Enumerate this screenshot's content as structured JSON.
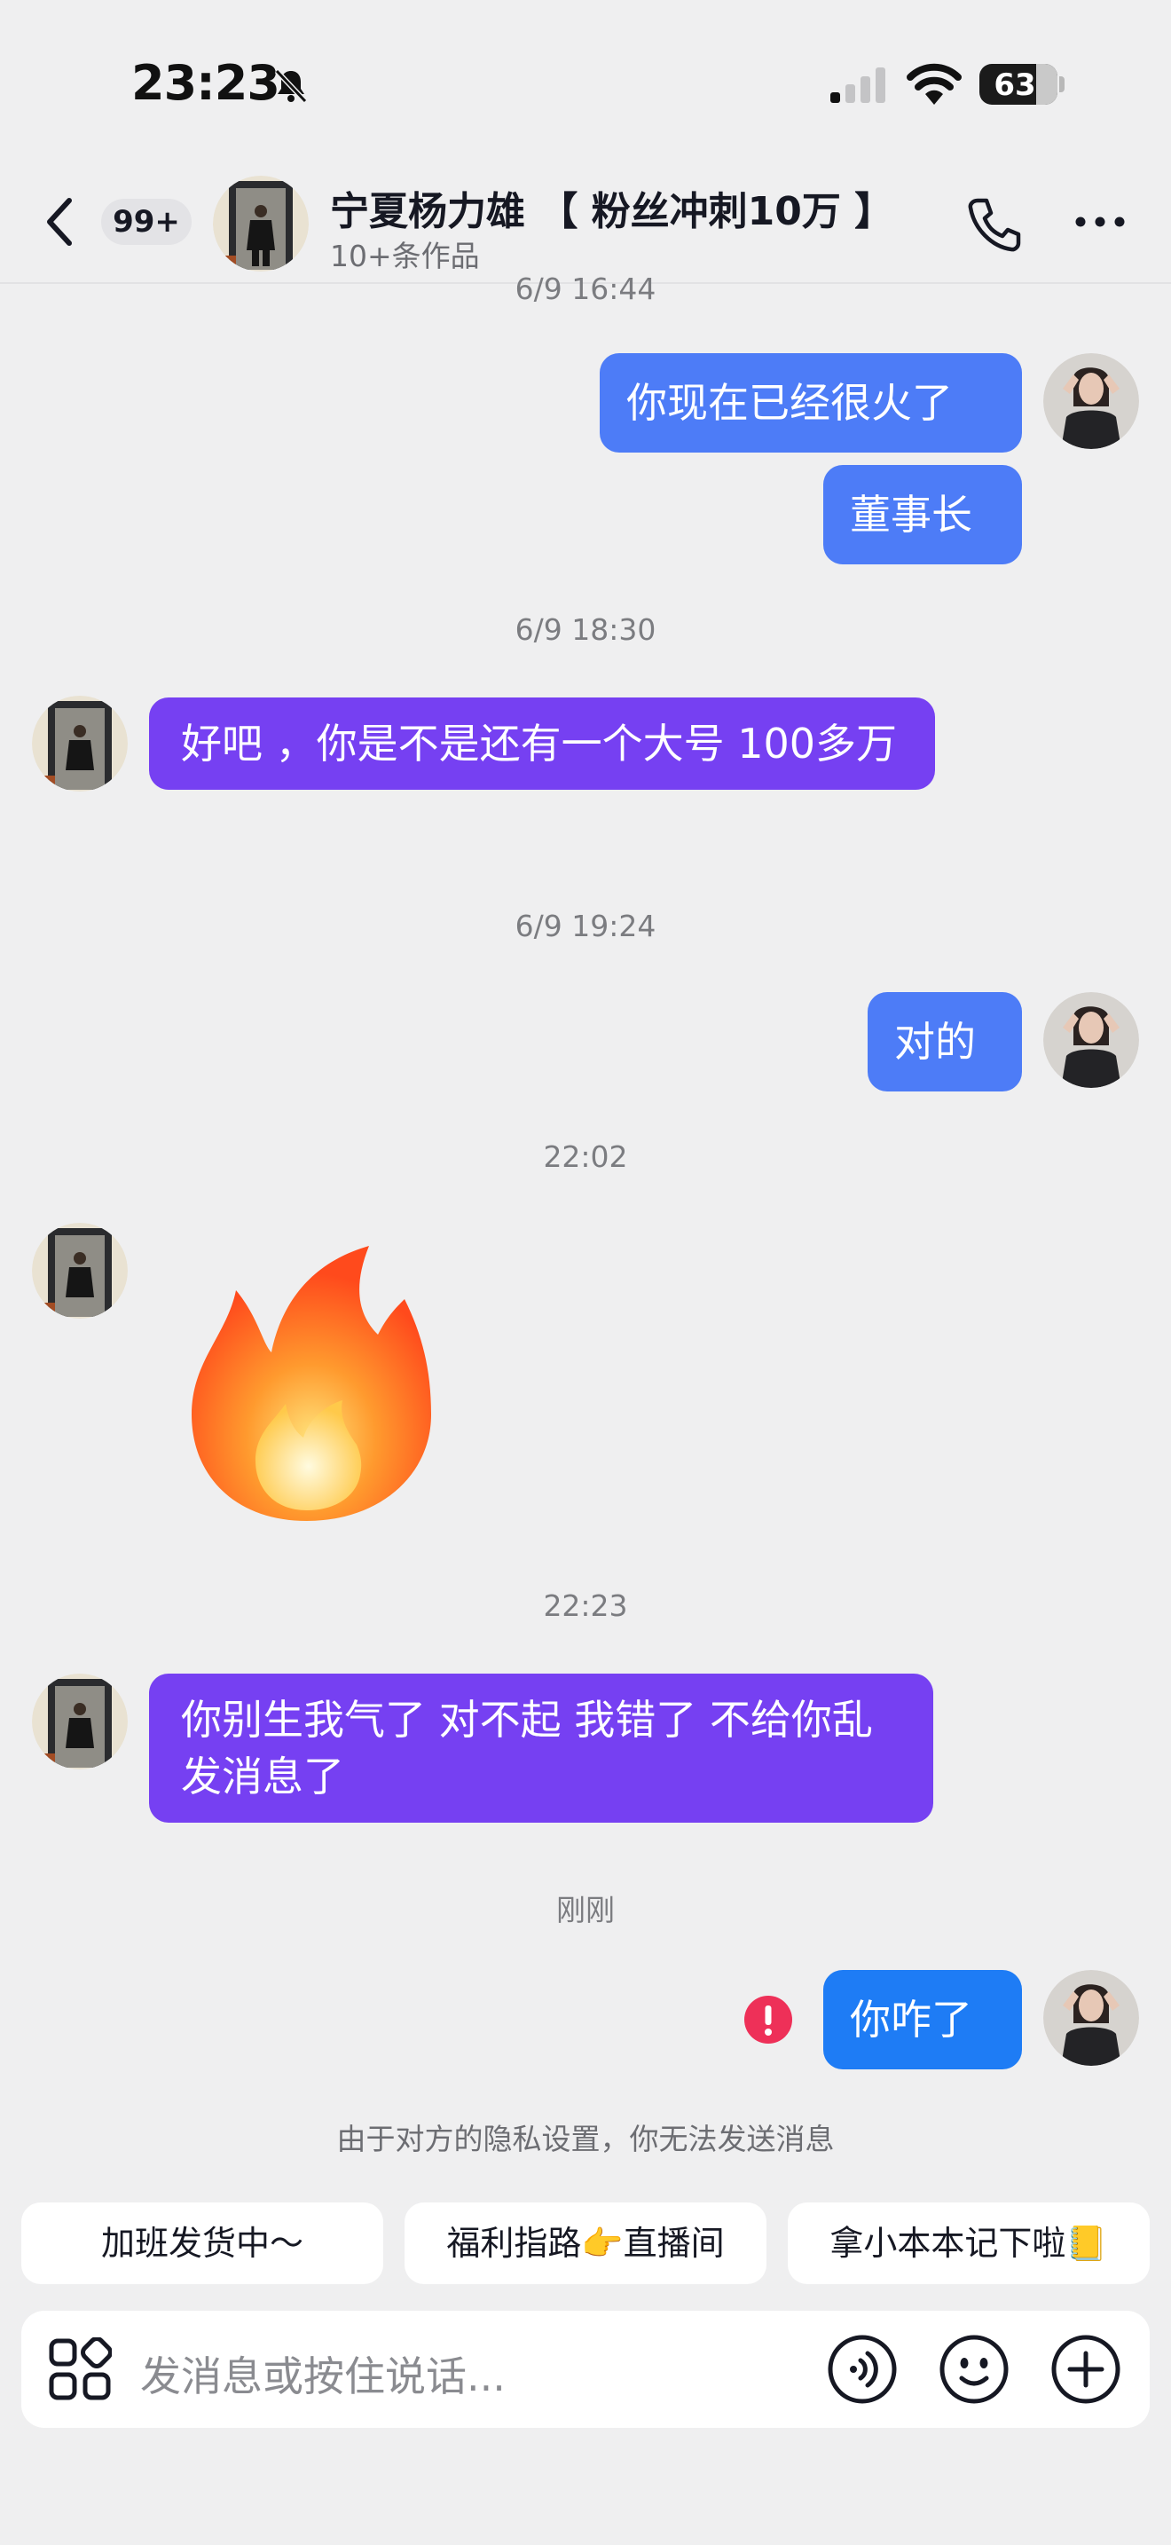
{
  "status_bar": {
    "time": "23:23",
    "battery": "63"
  },
  "header": {
    "unread_badge": "99+",
    "contact_name": "宁夏杨力雄 【 粉丝冲刺10万 】",
    "contact_subtitle": "10+条作品"
  },
  "messages": [
    {
      "type": "timestamp",
      "text": "6/9 16:44"
    },
    {
      "type": "text",
      "from": "me",
      "text": "你现在已经很火了"
    },
    {
      "type": "text",
      "from": "me",
      "text": "董事长"
    },
    {
      "type": "timestamp",
      "text": "6/9 18:30"
    },
    {
      "type": "text",
      "from": "them",
      "text": "好吧 ，你是不是还有一个大号  100多万"
    },
    {
      "type": "timestamp",
      "text": "6/9 19:24"
    },
    {
      "type": "text",
      "from": "me",
      "text": "对的"
    },
    {
      "type": "timestamp",
      "text": "22:02"
    },
    {
      "type": "sticker",
      "from": "them",
      "icon": "fire-sticker-icon"
    },
    {
      "type": "timestamp",
      "text": "22:23"
    },
    {
      "type": "text",
      "from": "them",
      "text": "你别生我气了  对不起  我错了  不给你乱发消息了"
    },
    {
      "type": "timestamp",
      "text": "刚刚"
    },
    {
      "type": "text",
      "from": "me",
      "text": "你咋了",
      "failed": true
    }
  ],
  "privacy_note": "由于对方的隐私设置，你无法发送消息",
  "quick_replies": [
    "加班发货中～",
    "福利指路👉直播间",
    "拿小本本记下啦📒"
  ],
  "input": {
    "placeholder": "发消息或按住说话..."
  },
  "colors": {
    "my_bubble": "#4d7cf7",
    "their_bubble": "#7640f2",
    "failed_badge": "#ee3058"
  }
}
